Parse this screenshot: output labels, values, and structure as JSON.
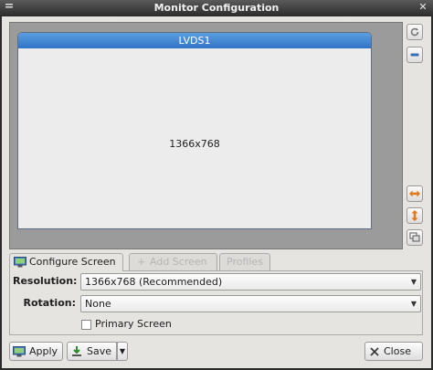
{
  "window": {
    "title": "Monitor Configuration",
    "close_glyph": "✕"
  },
  "preview": {
    "monitor_name": "LVDS1",
    "monitor_resolution": "1366x768"
  },
  "side_tools": [
    {
      "name": "rotate-icon",
      "glyph": "↻"
    },
    {
      "name": "zoom-out-icon",
      "glyph": "−"
    },
    {
      "name": "mirror-horizontal-icon",
      "glyph": "⇔"
    },
    {
      "name": "mirror-vertical-icon",
      "glyph": "⇕"
    },
    {
      "name": "clone-icon",
      "glyph": "❐"
    }
  ],
  "tabs": [
    {
      "label": "Configure Screen",
      "active": true
    },
    {
      "label": "Add Screen",
      "active": false
    },
    {
      "label": "Profiles",
      "active": false
    }
  ],
  "form": {
    "resolution_label": "Resolution:",
    "resolution_value": "1366x768 (Recommended)",
    "rotation_label": "Rotation:",
    "rotation_value": "None",
    "primary_label": "Primary Screen",
    "primary_checked": false
  },
  "buttons": {
    "apply": "Apply",
    "save": "Save",
    "close": "Close"
  },
  "colors": {
    "monitor_header": "#2f74c7",
    "accent_orange": "#e07a1f",
    "accent_blue": "#3a6fb5"
  }
}
